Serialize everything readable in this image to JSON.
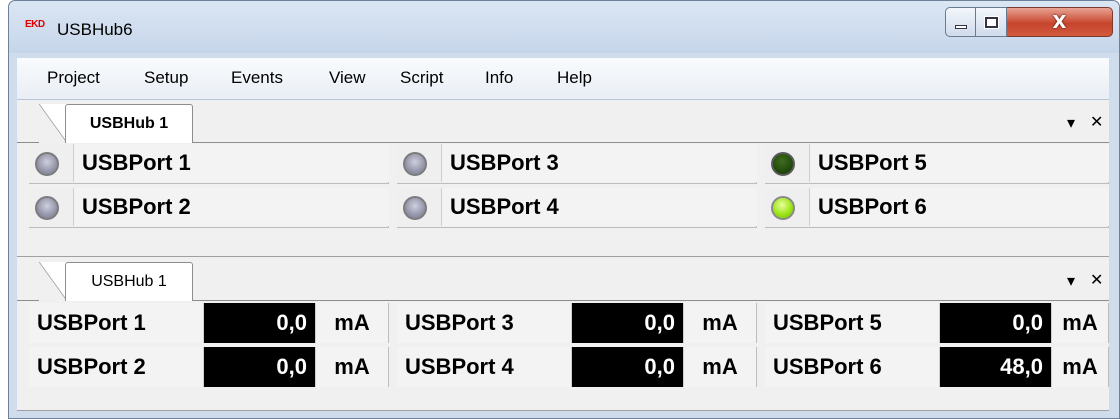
{
  "window": {
    "title": "USBHub6",
    "logo_text": "EKD",
    "close_glyph": "X"
  },
  "menu": [
    "Project",
    "Setup",
    "Events",
    "View",
    "Script",
    "Info",
    "Help"
  ],
  "panel_top": {
    "tab_label": "USBHub 1",
    "dropdown_glyph": "▾",
    "close_glyph": "✕",
    "ports": [
      {
        "label": "USBPort 1",
        "led": "off"
      },
      {
        "label": "USBPort 2",
        "led": "off"
      },
      {
        "label": "USBPort 3",
        "led": "off"
      },
      {
        "label": "USBPort 4",
        "led": "off"
      },
      {
        "label": "USBPort 5",
        "led": "dark-green"
      },
      {
        "label": "USBPort 6",
        "led": "bright-green"
      }
    ]
  },
  "panel_bottom": {
    "tab_label": "USBHub 1",
    "dropdown_glyph": "▾",
    "close_glyph": "✕",
    "currents": [
      {
        "label": "USBPort 1",
        "value": "0,0",
        "unit": "mA"
      },
      {
        "label": "USBPort 2",
        "value": "0,0",
        "unit": "mA"
      },
      {
        "label": "USBPort 3",
        "value": "0,0",
        "unit": "mA"
      },
      {
        "label": "USBPort 4",
        "value": "0,0",
        "unit": "mA"
      },
      {
        "label": "USBPort 5",
        "value": "0,0",
        "unit": "mA"
      },
      {
        "label": "USBPort 6",
        "value": "48,0",
        "unit": "mA"
      }
    ]
  },
  "colors": {
    "led_off": "#9a9aae",
    "led_dark_green": "#224c0d",
    "led_bright_green": "#9ee51a",
    "value_background": "#000000",
    "value_text": "#ffffff"
  }
}
